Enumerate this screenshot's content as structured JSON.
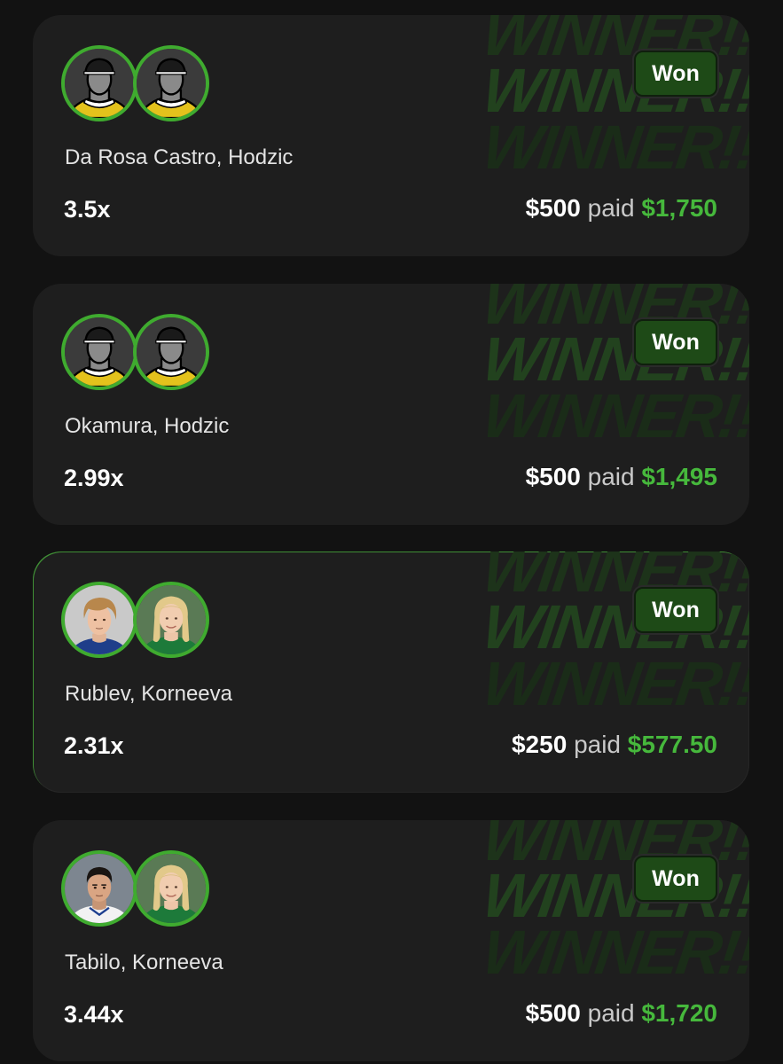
{
  "watermark_text": "WINNER!!",
  "colors": {
    "background": "#121212",
    "card": "#1e1e1e",
    "accent_green": "#46b83c",
    "badge_green": "#1e4a17",
    "avatar_ring": "#3fab2f"
  },
  "cards": [
    {
      "badge": "Won",
      "players": "Da Rosa Castro, Hodzic",
      "avatars": [
        "placeholder-silhouette-icon",
        "placeholder-silhouette-icon"
      ],
      "multiplier": "3.5x",
      "stake": "$500",
      "paid_label": "paid",
      "payout": "$1,750"
    },
    {
      "badge": "Won",
      "players": "Okamura, Hodzic",
      "avatars": [
        "placeholder-silhouette-icon",
        "placeholder-silhouette-icon"
      ],
      "multiplier": "2.99x",
      "stake": "$500",
      "paid_label": "paid",
      "payout": "$1,495"
    },
    {
      "badge": "Won",
      "players": "Rublev, Korneeva",
      "avatars": [
        "player-photo-rublev",
        "player-photo-korneeva"
      ],
      "multiplier": "2.31x",
      "stake": "$250",
      "paid_label": "paid",
      "payout": "$577.50"
    },
    {
      "badge": "Won",
      "players": "Tabilo, Korneeva",
      "avatars": [
        "player-photo-tabilo",
        "player-photo-korneeva"
      ],
      "multiplier": "3.44x",
      "stake": "$500",
      "paid_label": "paid",
      "payout": "$1,720"
    }
  ]
}
